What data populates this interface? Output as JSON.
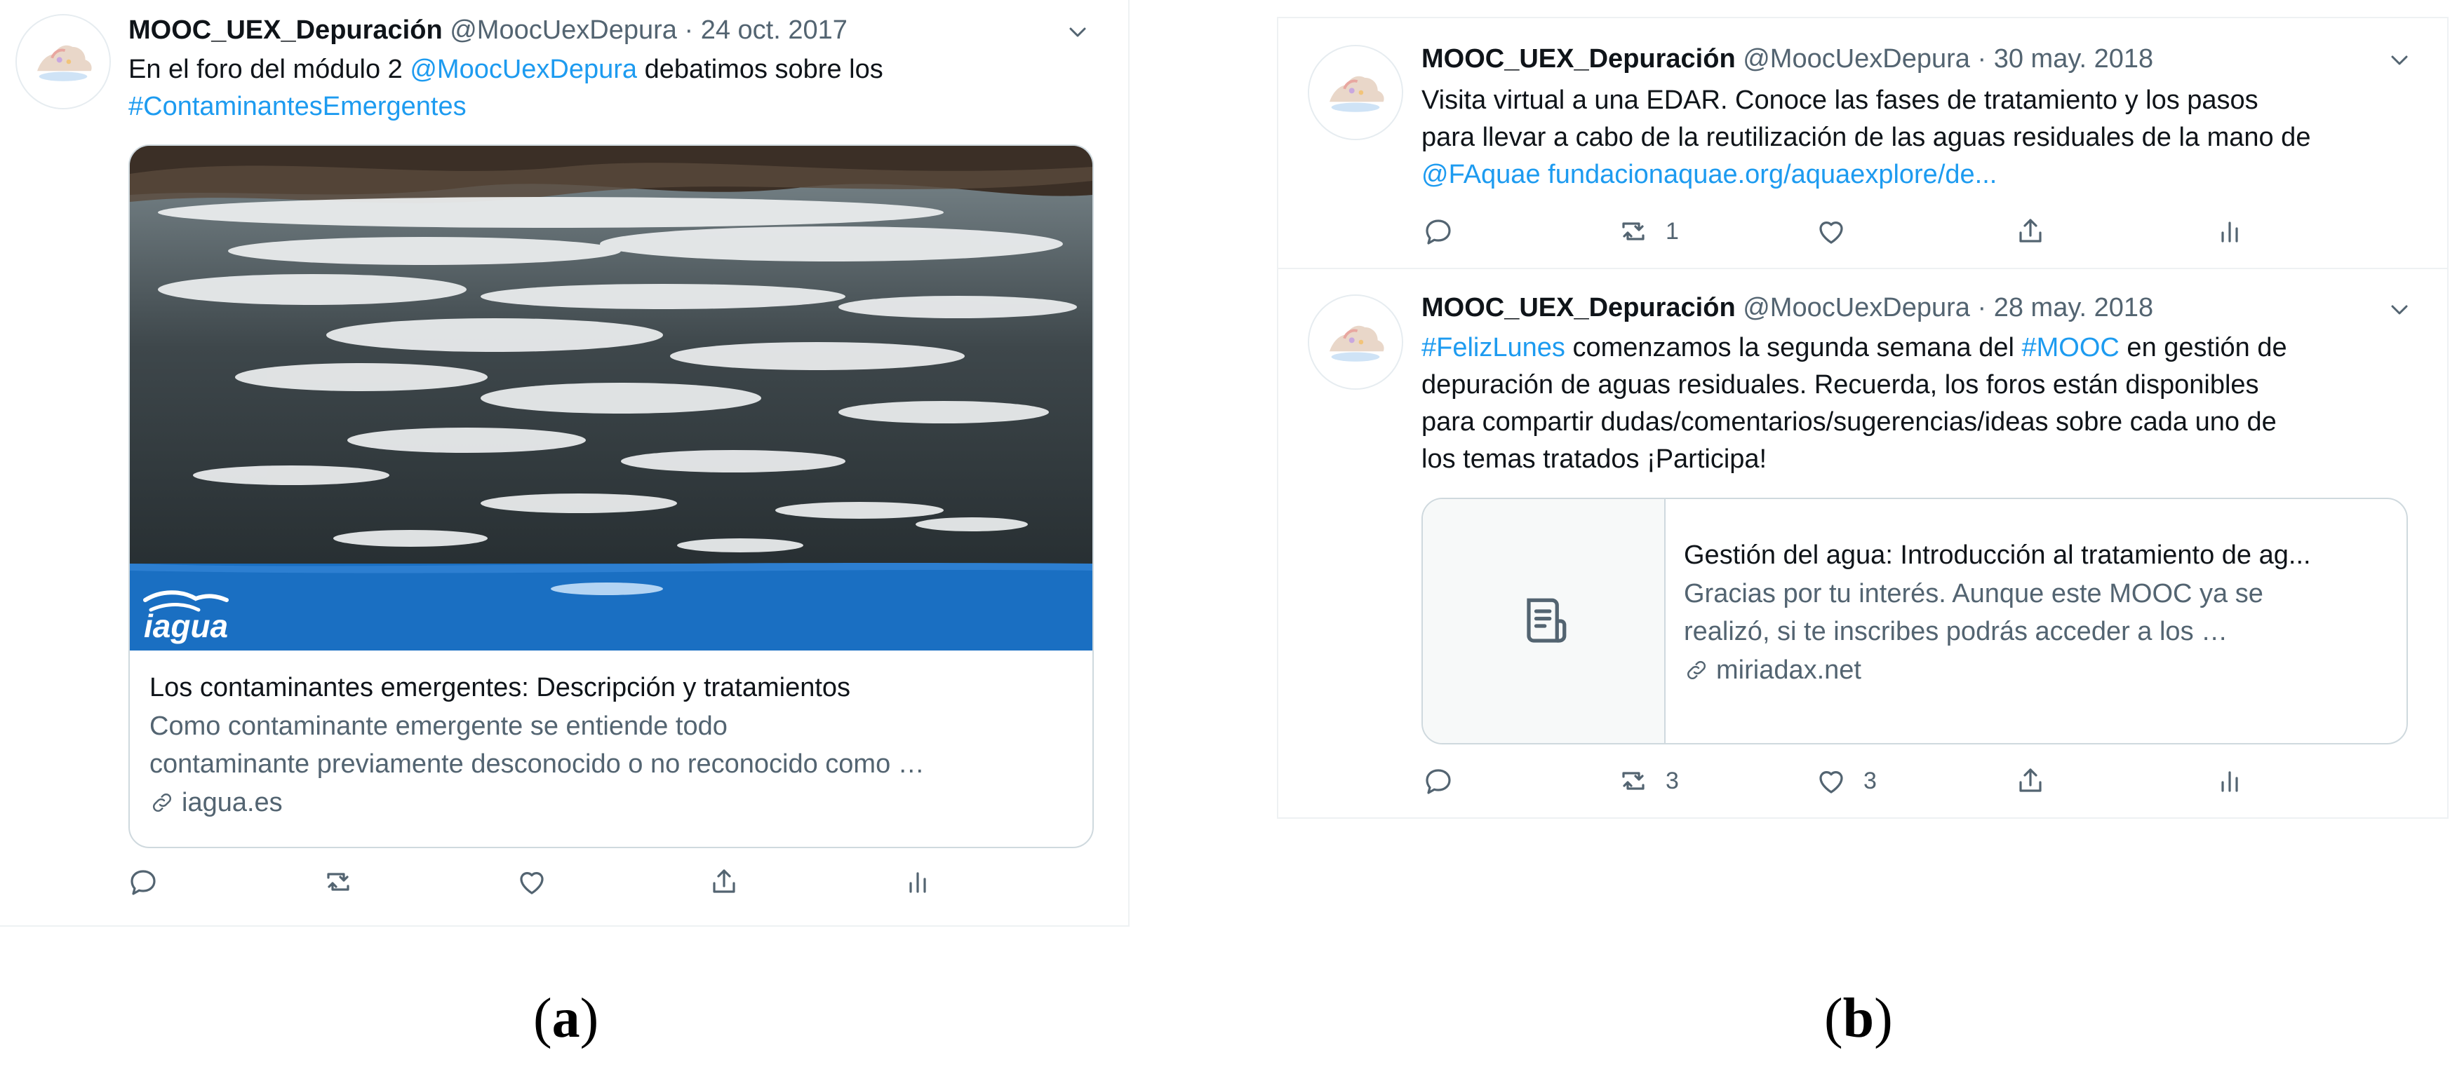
{
  "panel_a": {
    "caption": {
      "open": "(",
      "letter": "a",
      "close": ")"
    },
    "tweet": {
      "name": "MOOC_UEX_Depuración",
      "handle": "@MoocUexDepura",
      "sep": " · ",
      "date": "24 oct. 2017",
      "text_1": "En el foro del módulo 2 ",
      "mention": "@MoocUexDepura",
      "text_2": " debatimos sobre los",
      "hashtag": "#ContaminantesEmergentes",
      "card": {
        "image_label": "iagua",
        "title": "Los contaminantes emergentes: Descripción y tratamientos",
        "desc_line1": "Como contaminante emergente se entiende todo",
        "desc_line2": "contaminante previamente desconocido o no reconocido como …",
        "domain": "iagua.es"
      }
    }
  },
  "panel_b": {
    "caption": {
      "open": "(",
      "letter": "b",
      "close": ")"
    },
    "tweet1": {
      "name": "MOOC_UEX_Depuración",
      "handle": "@MoocUexDepura",
      "sep": " · ",
      "date": "30 may. 2018",
      "line1": "Visita virtual a una EDAR. Conoce las fases de tratamiento y los pasos",
      "line2": "para llevar a cabo de la reutilización de las aguas residuales de la mano de",
      "mention": "@FAquae",
      "link_text": "fundacionaquae.org/aquaexplore/de...",
      "retweet_count": "1"
    },
    "tweet2": {
      "name": "MOOC_UEX_Depuración",
      "handle": "@MoocUexDepura",
      "sep": " · ",
      "date": "28 may. 2018",
      "hashtag1": "#FelizLunes",
      "line1_mid": " comenzamos la segunda semana del ",
      "hashtag2": "#MOOC",
      "line1_end": " en gestión de",
      "line2": "depuración de aguas residuales. Recuerda, los foros están disponibles",
      "line3": "para compartir dudas/comentarios/sugerencias/ideas sobre cada uno de",
      "line4": "los temas tratados ¡Participa!",
      "card": {
        "title": "Gestión del agua: Introducción al tratamiento de ag...",
        "desc_line1": "Gracias por tu interés. Aunque este MOOC ya se",
        "desc_line2": "realizó, si te inscribes podrás acceder a los …",
        "domain": "miriadax.net"
      },
      "retweet_count": "3",
      "like_count": "3"
    }
  },
  "colors": {
    "link": "#1d9bf0",
    "meta": "#536471",
    "text": "#0f1419",
    "border": "#cfd9de",
    "iagua_band": "#1a6fc2"
  },
  "icons": [
    "reply-icon",
    "retweet-icon",
    "like-icon",
    "share-icon",
    "analytics-icon",
    "chevron-down-icon",
    "link-icon",
    "document-icon"
  ]
}
